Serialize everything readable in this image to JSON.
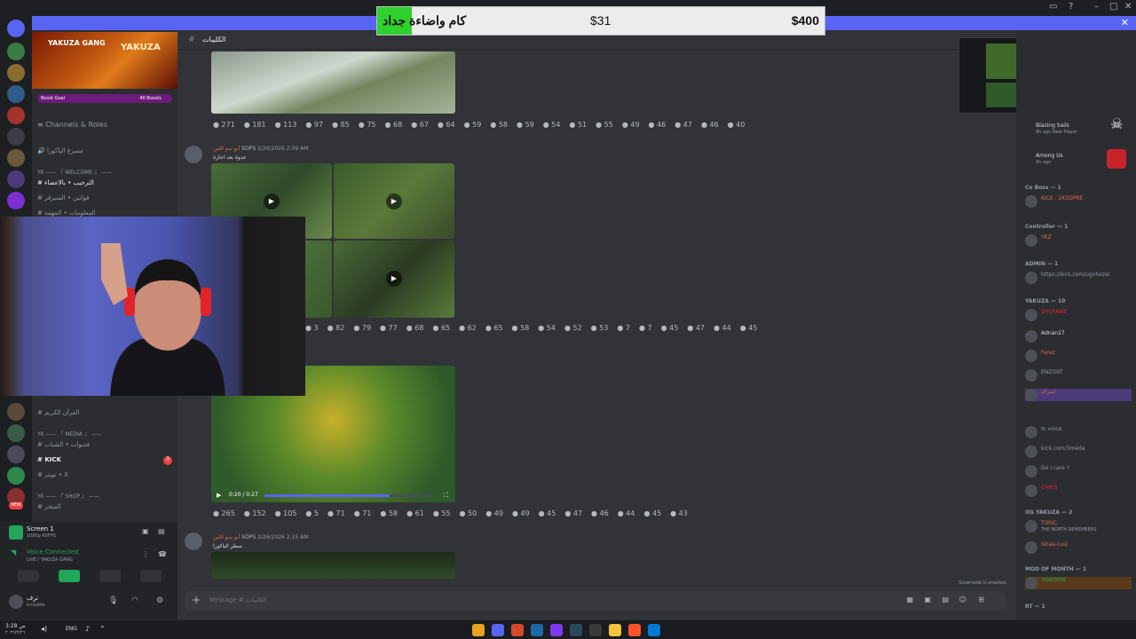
{
  "goal": {
    "label": "كام واضاءة جداد",
    "current": "$31",
    "target": "$400",
    "progress": 0.0775
  },
  "server": {
    "name": "YAKUZA GANG",
    "banner_text": "YAKUZA",
    "boost_goal_label": "Boost Goal",
    "boost_count": "40 Boosts"
  },
  "sidebar": {
    "channels_roles": "Channels & Roles",
    "items": [
      {
        "label": "مسرع الياكوزا",
        "type": "voice"
      },
      {
        "label": "YK —— 『 WELCOME 』 ——",
        "type": "category"
      },
      {
        "label": "الترحيب • بالاعضاء",
        "type": "text"
      },
      {
        "label": "قوانين • السيرفر",
        "type": "text"
      },
      {
        "label": "المعلومات • المهمة",
        "type": "text"
      },
      {
        "label": "القرآن الكريم",
        "type": "text"
      },
      {
        "label": "YK —— 『 MEDIA 』 ——",
        "type": "category"
      },
      {
        "label": "فديوات • الشباب",
        "type": "text"
      },
      {
        "label": "KICK",
        "type": "text",
        "badge": "3"
      },
      {
        "label": "تويتر • X",
        "type": "text"
      },
      {
        "label": "YK —— 『 SHOP 』 ——",
        "type": "category"
      },
      {
        "label": "المتجر",
        "type": "text"
      }
    ]
  },
  "user_panel": {
    "stream_title": "Screen 1",
    "stream_sub": "1080p 60FPS",
    "voice_status": "Voice Connected",
    "voice_channel": "LIVE / YAKUZA GANG",
    "username": "ترف",
    "user_status": "Invisible"
  },
  "chat": {
    "channel_name": "الكليبات",
    "composer_placeholder": "Message # الكليبات",
    "slowmode": "Slowmode is enabled.",
    "messages": [
      {
        "reactions": [
          "271",
          "181",
          "113",
          "97",
          "85",
          "75",
          "68",
          "67",
          "64",
          "59",
          "58",
          "59",
          "54",
          "51",
          "55",
          "49",
          "46",
          "47",
          "46",
          "40"
        ]
      },
      {
        "author": "أبو سو اللبن",
        "tag": "SOPS",
        "timestamp": "2/26/2026 2:09 AM",
        "text": "عدوة بعد اجازة",
        "reactions": [
          "3",
          "82",
          "79",
          "77",
          "68",
          "65",
          "62",
          "65",
          "58",
          "54",
          "52",
          "53",
          "7",
          "7",
          "45",
          "47",
          "44",
          "45"
        ]
      },
      {
        "video_time": "0:20 / 0:27",
        "reactions": [
          "265",
          "152",
          "105",
          "5",
          "71",
          "71",
          "58",
          "61",
          "55",
          "50",
          "49",
          "49",
          "45",
          "47",
          "46",
          "44",
          "45",
          "43"
        ]
      },
      {
        "author": "أبو سو اللبن",
        "tag": "SOPS",
        "timestamp": "2/26/2026 2:15 AM",
        "text": "سطر الياكوزا"
      }
    ]
  },
  "members": {
    "activities": [
      {
        "name": "Blazing Sails",
        "sub": "9h ago  New Player"
      },
      {
        "name": "Among Us",
        "sub": "9h ago"
      }
    ],
    "groups": [
      {
        "role": "Co Boss — 1",
        "members": [
          {
            "name": "KICK : 2K5DPRE",
            "tag": "YKZ"
          }
        ]
      },
      {
        "role": "Controller — 1",
        "members": [
          {
            "name": "",
            "tag": "YKZ"
          }
        ]
      },
      {
        "role": "ADMIN — 1",
        "members": [
          {
            "name": "https://kick.com/ugxhozei",
            "tag": "RT"
          }
        ]
      },
      {
        "role": "YAKUZA — 10",
        "members": [
          {
            "name": "SHOFAWE",
            "tag": "INF"
          },
          {
            "name": "Adnan27",
            "tag": ""
          },
          {
            "name": "Farez",
            "tag": ""
          },
          {
            "name": "ENZO9T",
            "tag": "YKZ"
          },
          {
            "name": "اسراك",
            "tag": "YKZ"
          },
          {
            "name": "In voice",
            "tag": ""
          },
          {
            "name": "In voice",
            "tag": "YKZ"
          },
          {
            "name": "kick.com/3meda",
            "tag": "SOPS"
          },
          {
            "name": "Do I care ?",
            "tag": ""
          },
          {
            "name": "CHRIS",
            "tag": "YKZ"
          }
        ]
      },
      {
        "role": "OG YAKUZA — 2",
        "members": [
          {
            "name": "TOXIC",
            "tag": "CODE",
            "sub": "THE NORTH REMEMBERS"
          },
          {
            "name": "Ishaa-Luiz",
            "tag": "RT"
          }
        ]
      },
      {
        "role": "MOD OF MONTH — 1",
        "members": [
          {
            "name": "3BAHANE",
            "tag": ""
          }
        ]
      },
      {
        "role": "RT — 1",
        "members": []
      }
    ]
  },
  "taskbar": {
    "lang": "ENG",
    "time": "3:28 ص",
    "date": "٢٠٢٦/٢/٢٦"
  },
  "colors": {
    "accent": "#5865f2",
    "goal_fill": "#2fd12f",
    "background": "#313338",
    "sidebar": "#2b2d31",
    "rail": "#1e1f22"
  }
}
